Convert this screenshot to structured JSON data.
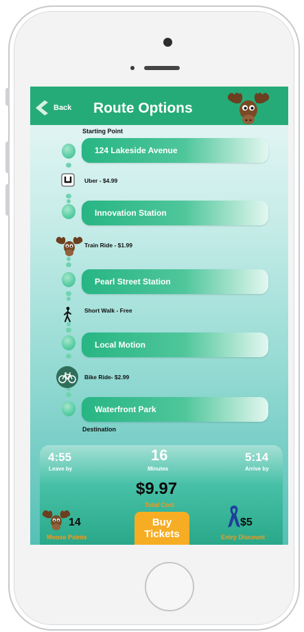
{
  "header": {
    "back_label": "Back",
    "title": "Route Options"
  },
  "route": {
    "start_label": "Starting Point",
    "end_label": "Destination",
    "stops": [
      {
        "name": "124 Lakeside Avenue"
      },
      {
        "name": "Innovation Station"
      },
      {
        "name": "Pearl Street Station"
      },
      {
        "name": "Local Motion"
      },
      {
        "name": "Waterfront Park"
      }
    ],
    "legs": [
      {
        "icon": "uber-icon",
        "text": "Uber - $4.99"
      },
      {
        "icon": "moose-train-icon",
        "text": "Train Ride - $1.99"
      },
      {
        "icon": "walking-person-icon",
        "text": "Short Walk - Free"
      },
      {
        "icon": "bicycle-icon",
        "text": "Bike Ride- $2.99"
      }
    ]
  },
  "summary": {
    "leave_time": "4:55",
    "leave_label": "Leave by",
    "duration": "16",
    "duration_label": "Minutes",
    "arrive_time": "5:14",
    "arrive_label": "Arrive by",
    "total_cost": "$9.97",
    "total_cost_label": "Total Cost",
    "moose_points": "14",
    "moose_points_label": "Moose Points",
    "buy_line1": "Buy",
    "buy_line2": "Tickets",
    "discount": "$5",
    "discount_label": "Entry Discount"
  },
  "colors": {
    "header_green": "#25ab78",
    "accent_orange": "#f29a1f",
    "button_orange": "#f6ad24",
    "ribbon_blue": "#1d3f9a"
  }
}
